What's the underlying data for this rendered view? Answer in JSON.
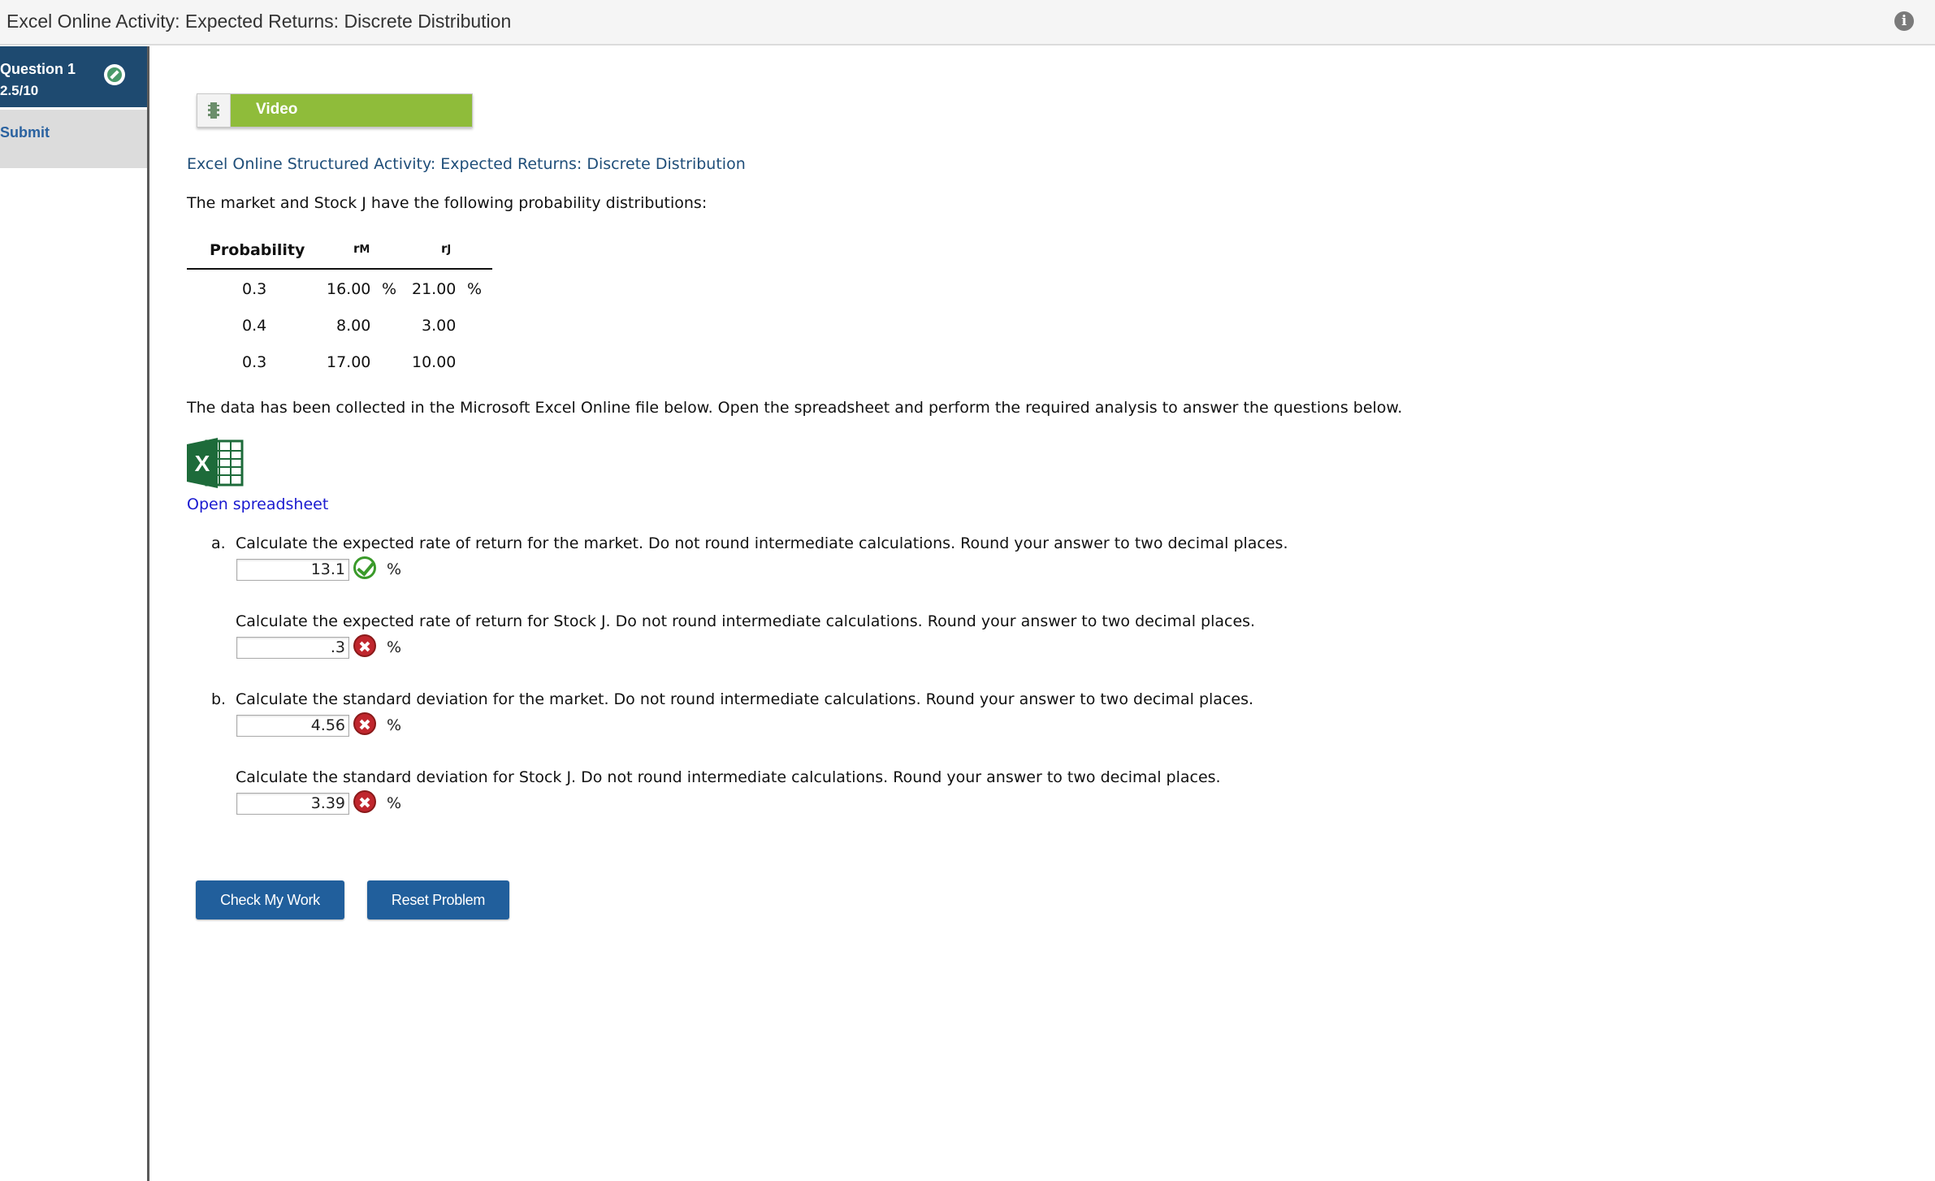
{
  "window": {
    "title": "Excel Online Activity: Expected Returns: Discrete Distribution",
    "info_icon": "info-icon"
  },
  "sidebar": {
    "question_label": "Question 1",
    "question_score": "2.5/10",
    "submit_label": "Submit"
  },
  "content": {
    "video_label": "Video",
    "activity_title": "Excel Online Structured Activity: Expected Returns: Discrete Distribution",
    "intro": "The market and Stock J have the following probability distributions:",
    "table": {
      "headers": {
        "probability": "Probability",
        "rm": "rM",
        "rj": "rJ"
      },
      "rows": [
        {
          "probability": "0.3",
          "rm": "16.00",
          "rm_unit": "%",
          "rj": "21.00",
          "rj_unit": "%"
        },
        {
          "probability": "0.4",
          "rm": "8.00",
          "rj": "3.00"
        },
        {
          "probability": "0.3",
          "rm": "17.00",
          "rj": "10.00"
        }
      ]
    },
    "data_note": "The data has been collected in the Microsoft Excel Online file below. Open the spreadsheet and perform the required analysis to answer the questions below.",
    "excel_icon_letter": "X",
    "open_link": "Open spreadsheet",
    "questions": [
      {
        "letter": "a.",
        "text": "Calculate the expected rate of return for the market. Do not round intermediate calculations. Round your answer to two decimal places.",
        "value": "13.1",
        "status": "correct",
        "unit": "%"
      },
      {
        "letter": "",
        "text": "Calculate the expected rate of return for Stock J. Do not round intermediate calculations. Round your answer to two decimal places.",
        "value": ".3",
        "status": "incorrect",
        "unit": "%"
      },
      {
        "letter": "b.",
        "text": "Calculate the standard deviation for the market. Do not round intermediate calculations. Round your answer to two decimal places.",
        "value": "4.56",
        "status": "incorrect",
        "unit": "%"
      },
      {
        "letter": "",
        "text": "Calculate the standard deviation for Stock J. Do not round intermediate calculations. Round your answer to two decimal places.",
        "value": "3.39",
        "status": "incorrect",
        "unit": "%"
      }
    ],
    "buttons": {
      "check": "Check My Work",
      "reset": "Reset Problem"
    }
  },
  "colors": {
    "sidebar_active": "#1e4a70",
    "video_green": "#8fbc3a",
    "button_blue": "#215f9c",
    "title_blue": "#1f4e79",
    "link_blue": "#1a1ad0"
  }
}
